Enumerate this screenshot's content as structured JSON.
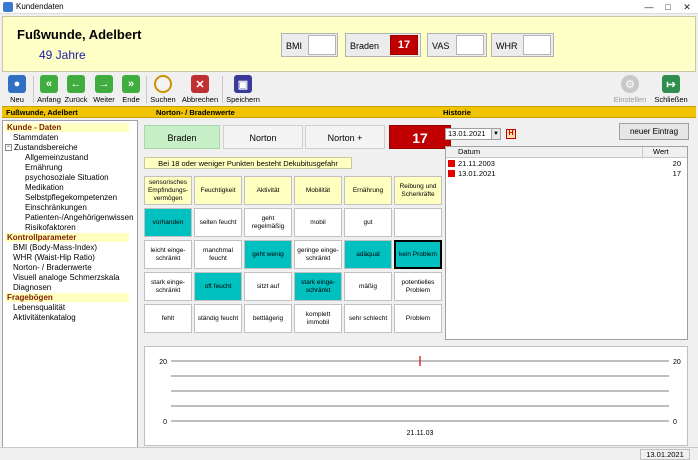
{
  "window": {
    "title": "Kundendaten"
  },
  "patient": {
    "name": "Fußwunde, Adelbert",
    "age": "49 Jahre"
  },
  "header_fields": [
    {
      "label": "BMI",
      "value": ""
    },
    {
      "label": "Braden",
      "value": "17"
    },
    {
      "label": "VAS",
      "value": ""
    },
    {
      "label": "WHR",
      "value": ""
    }
  ],
  "toolbar": {
    "neu": "Neu",
    "anfang": "Anfang",
    "zurueck": "Zurück",
    "weiter": "Weiter",
    "ende": "Ende",
    "suchen": "Suchen",
    "abbrechen": "Abbrechen",
    "speichern": "Speichern",
    "einstellen": "Einstellen",
    "schliessen": "Schließen"
  },
  "section_bar": {
    "patient": "Fußwunde,  Adelbert",
    "section": "Norton- / Bradenwerte",
    "history": "Historie"
  },
  "tree": [
    {
      "text": "Kunde - Daten",
      "type": "head"
    },
    {
      "text": "Stammdaten",
      "type": "item",
      "level": 1
    },
    {
      "text": "Zustandsbereiche",
      "type": "group",
      "level": 0
    },
    {
      "text": "Allgemeinzustand",
      "type": "item",
      "level": 2
    },
    {
      "text": "Ernährung",
      "type": "item",
      "level": 2
    },
    {
      "text": "psychosoziale Situation",
      "type": "item",
      "level": 2
    },
    {
      "text": "Medikation",
      "type": "item",
      "level": 2
    },
    {
      "text": "Selbstpflegekompetenzen",
      "type": "item",
      "level": 2
    },
    {
      "text": "Einschränkungen",
      "type": "item",
      "level": 2
    },
    {
      "text": "Patienten-/Angehörigenwissen",
      "type": "item",
      "level": 2
    },
    {
      "text": "Risikofaktoren",
      "type": "item",
      "level": 2
    },
    {
      "text": "Kontrollparameter",
      "type": "head"
    },
    {
      "text": "BMI (Body-Mass-Index)",
      "type": "item",
      "level": 1
    },
    {
      "text": "WHR (Waist-Hip Ratio)",
      "type": "item",
      "level": 1
    },
    {
      "text": "Norton- / Bradenwerte",
      "type": "item",
      "level": 1
    },
    {
      "text": "Visuell analoge Schmerzskala",
      "type": "item",
      "level": 1
    },
    {
      "text": "Diagnosen",
      "type": "item",
      "level": 1
    },
    {
      "text": "Fragebögen",
      "type": "head"
    },
    {
      "text": "Lebensqualität",
      "type": "item",
      "level": 1
    },
    {
      "text": "Aktivitätenkatalog",
      "type": "item",
      "level": 1
    }
  ],
  "tabs": [
    {
      "label": "Braden",
      "active": true
    },
    {
      "label": "Norton",
      "active": false
    },
    {
      "label": "Norton +",
      "active": false
    }
  ],
  "score": "17",
  "hint": "Bei 18 oder weniger Punkten besteht Dekubitusgefahr",
  "grid": {
    "headers": [
      "sensorisches Empfindungs-vermögen",
      "Feuchtigkeit",
      "Aktivität",
      "Mobilität",
      "Ernährung",
      "Reibung und Scherkräfte"
    ],
    "rows": [
      [
        "vorhanden",
        "selten feucht",
        "geht regelmäßig",
        "mobil",
        "gut",
        ""
      ],
      [
        "leicht einge-schränkt",
        "manchmal feucht",
        "geht wenig",
        "geringe einge-schränkt",
        "adäquat",
        "kein Problem"
      ],
      [
        "stark einge-schränkt",
        "oft feucht",
        "sitzt auf",
        "stark einge-schränkt",
        "mäßig",
        "potentielles Problem"
      ],
      [
        "fehlt",
        "ständig feucht",
        "bettlägerig",
        "komplett immobil",
        "sehr schlecht",
        "Problem"
      ]
    ],
    "selected": [
      {
        "row": 0,
        "col": 0
      },
      {
        "row": 1,
        "col": 2
      },
      {
        "row": 1,
        "col": 4
      },
      {
        "row": 1,
        "col": 5
      },
      {
        "row": 2,
        "col": 1
      },
      {
        "row": 2,
        "col": 3
      }
    ]
  },
  "history": {
    "date_value": "13.01.2021",
    "h_button": "H",
    "new_button": "neuer Eintrag",
    "col_date": "Datum",
    "col_value": "Wert",
    "rows": [
      {
        "date": "21.11.2003",
        "value": "20"
      },
      {
        "date": "13.01.2021",
        "value": "17"
      }
    ]
  },
  "chart_data": {
    "type": "line",
    "x": [
      "21.11.03"
    ],
    "values": [
      20
    ],
    "ylim": [
      0,
      20
    ],
    "yticks": [
      0,
      5,
      10,
      15,
      20
    ],
    "grid": true
  },
  "status": {
    "date": "13.01.2021"
  },
  "colors": {
    "accent_red": "#c00000",
    "selection": "#00c0c0",
    "header_yellow": "#ffffc8",
    "section_bar": "#f0c400"
  }
}
